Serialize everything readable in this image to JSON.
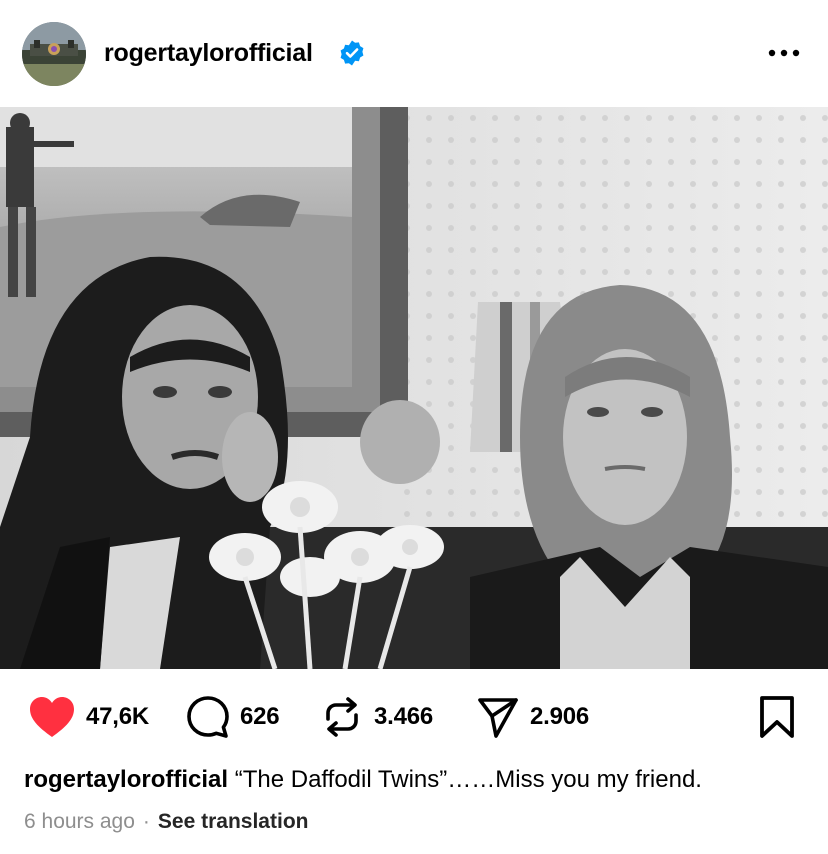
{
  "header": {
    "username": "rogertaylorofficial",
    "verified": true,
    "verified_icon": "verified-badge-icon",
    "more_icon": "more-options-icon"
  },
  "photo": {
    "style": "black-and-white"
  },
  "actions": {
    "likes": "47,6K",
    "comments": "626",
    "reposts": "3.466",
    "shares": "2.906",
    "liked": true,
    "like_color": "#ff3040",
    "icons": [
      "heart-icon",
      "comment-icon",
      "repost-icon",
      "share-icon",
      "bookmark-icon"
    ]
  },
  "caption": {
    "username": "rogertaylorofficial",
    "text": "“The Daffodil Twins”……Miss you my friend."
  },
  "meta": {
    "time": "6 hours ago",
    "separator": "·",
    "translate": "See translation"
  },
  "colors": {
    "verified_blue": "#0095f6",
    "muted_text": "#8e8e8e"
  }
}
